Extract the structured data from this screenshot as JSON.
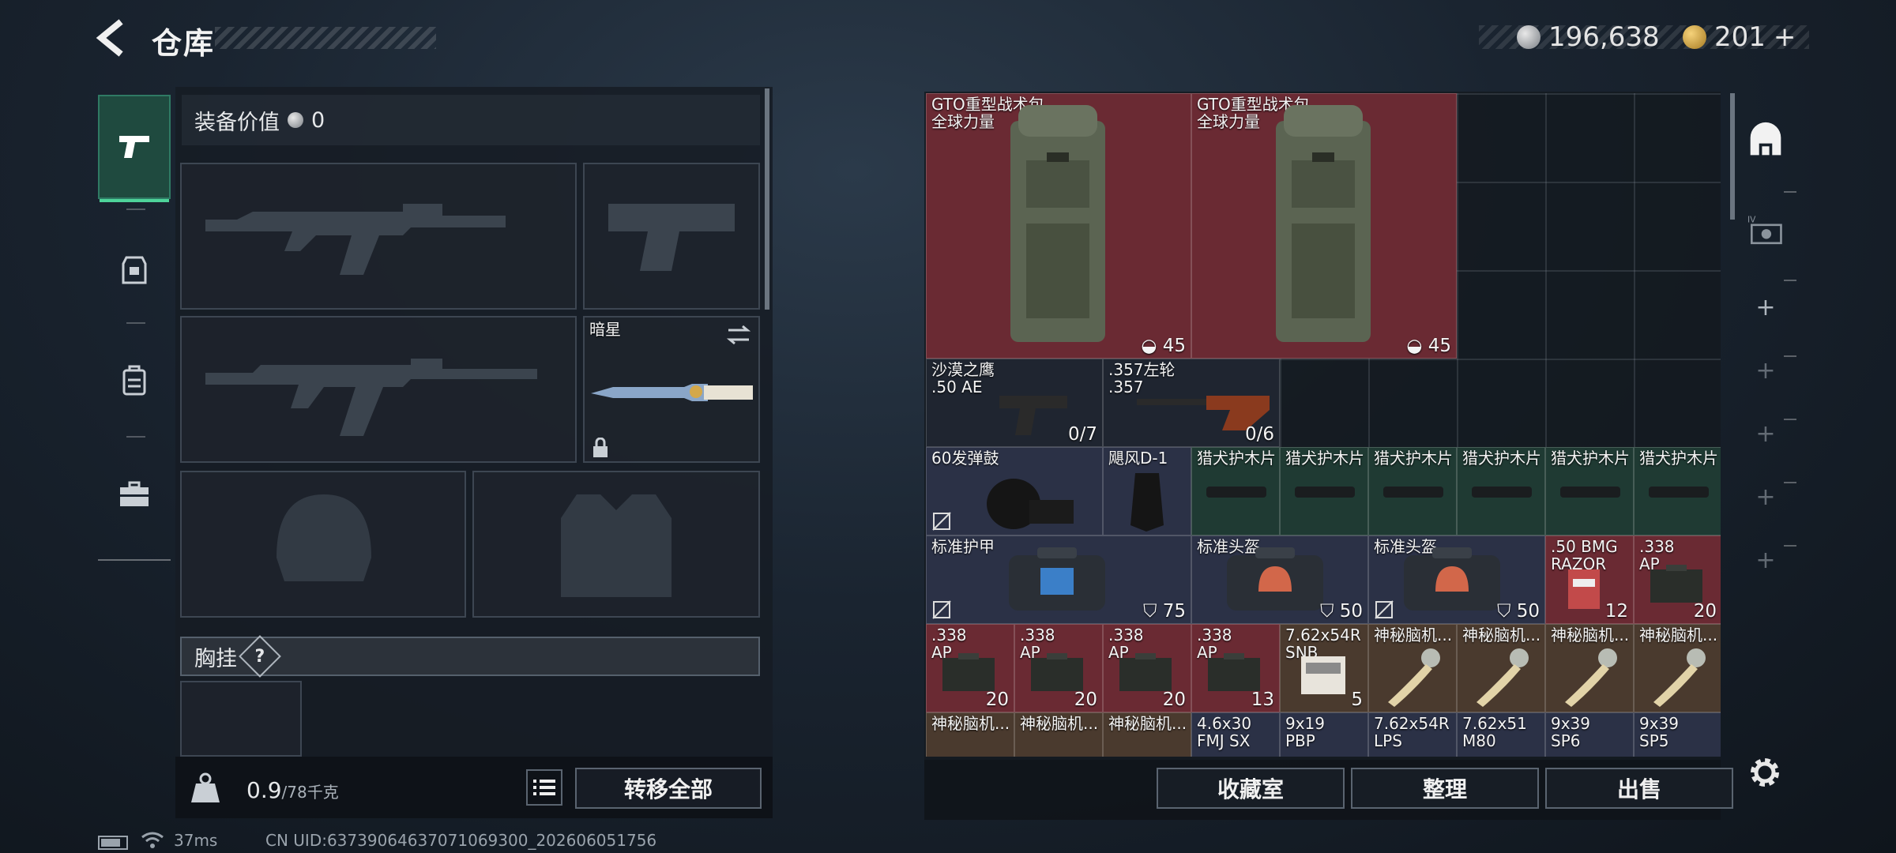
{
  "header": {
    "title": "仓库",
    "currency1": "196,638",
    "currency2": "201",
    "currency2_suffix": "+"
  },
  "nav": {
    "items": [
      "pistol-icon",
      "armor-icon",
      "backpack-icon",
      "toolbox-icon"
    ]
  },
  "left": {
    "equip_value_label": "装备价值",
    "equip_value": "0",
    "melee_name": "暗星",
    "chest_label": "胸挂",
    "chest_help": "?",
    "weight": "0.9",
    "weight_max": "/78千克",
    "transfer_all": "转移全部"
  },
  "items": {
    "bp1": {
      "name": "GTO重型战术包",
      "sub": "全球力量",
      "count": "45"
    },
    "bp2": {
      "name": "GTO重型战术包",
      "sub": "全球力量",
      "count": "45"
    },
    "deagle": {
      "name": "沙漠之鹰",
      "sub": ".50 AE",
      "count": "0/7"
    },
    "revolver": {
      "name": ".357左轮",
      "sub": ".357",
      "count": "0/6"
    },
    "drum": {
      "name": "60发弹鼓"
    },
    "hurricane": {
      "name": "飓风D-1"
    },
    "plates": [
      "猎犬护木片",
      "猎犬护木片",
      "猎犬护木片",
      "猎犬护木片",
      "猎犬护木片",
      "猎犬护木片"
    ],
    "armor": {
      "name": "标准护甲",
      "count": "75"
    },
    "helmet1": {
      "name": "标准头盔",
      "count": "50"
    },
    "helmet2": {
      "name": "标准头盔",
      "count": "50"
    },
    "bmg": {
      "name": ".50 BMG",
      "sub": "RAZOR",
      "count": "12"
    },
    "ap_top": {
      "name": ".338",
      "sub": "AP",
      "count": "20"
    },
    "ap_row": [
      {
        "name": ".338",
        "sub": "AP",
        "count": "20"
      },
      {
        "name": ".338",
        "sub": "AP",
        "count": "20"
      },
      {
        "name": ".338",
        "sub": "AP",
        "count": "20"
      },
      {
        "name": ".338",
        "sub": "AP",
        "count": "13"
      }
    ],
    "r762": {
      "name": "7.62x54R",
      "sub": "SNB",
      "count": "5"
    },
    "mystery": [
      "神秘脑机...",
      "神秘脑机...",
      "神秘脑机...",
      "神秘脑机..."
    ],
    "bottom": [
      {
        "name": "神秘脑机..."
      },
      {
        "name": "神秘脑机..."
      },
      {
        "name": "神秘脑机..."
      },
      {
        "name": "4.6x30",
        "sub": "FMJ SX"
      },
      {
        "name": "9x19",
        "sub": "PBP"
      },
      {
        "name": "7.62x54R",
        "sub": "LPS"
      },
      {
        "name": "7.62x51",
        "sub": "M80"
      },
      {
        "name": "9x39",
        "sub": "SP6"
      },
      {
        "name": "9x39",
        "sub": "SP5"
      }
    ]
  },
  "actions": {
    "collection": "收藏室",
    "organize": "整理",
    "sell": "出售"
  },
  "status": {
    "ping": "37ms",
    "uid": "CN UID:63739064637071069300_202606051756"
  },
  "colors": {
    "accent": "#4ed39a",
    "red_cell": "#6a2a33",
    "blue_cell": "#2b3146",
    "green_cell": "#1f3a33"
  }
}
